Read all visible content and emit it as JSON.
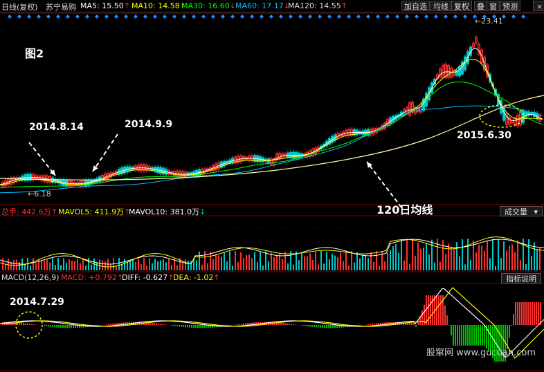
{
  "header": {
    "period": "日线(复权)",
    "stock": "苏宁易购",
    "ma": [
      {
        "label": "MA5: 15.50",
        "arrow": "↑",
        "color": "#ffffff"
      },
      {
        "label": "MA10: 14.58",
        "arrow": "↑",
        "color": "#ffff00"
      },
      {
        "label": "MA30: 16.60",
        "arrow": "↓",
        "color": "#00ff00"
      },
      {
        "label": "MA60: 17.17",
        "arrow": "↓",
        "color": "#00c0ff"
      },
      {
        "label": "MA120: 14.55",
        "arrow": "↑",
        "color": "#ffffff"
      }
    ],
    "buttons": [
      "加自选",
      "均线",
      "复权",
      "叠",
      "窗",
      "预测"
    ],
    "close_label": "×"
  },
  "main_chart": {
    "figure_label": "图2",
    "annotations": {
      "a1": "2014.8.14",
      "a2": "2014.9.9",
      "a3": "2015.6.30",
      "a4": "120日均线"
    },
    "high_label": "23.41",
    "low_label": "6.18"
  },
  "volume_panel": {
    "label_main": "总手: 442.6万",
    "label_main_arrow": "↑",
    "label_mavol5": "MAVOL5: 411.9万",
    "label_mavol5_arrow": "↑",
    "label_mavol10": "MAVOL10: 381.0万",
    "label_mavol10_arrow": "↓",
    "selector": "成交量"
  },
  "macd_panel": {
    "label_title": "MACD(12,26,9)",
    "label_macd": "MACD: +0.792",
    "label_macd_arrow": "↑",
    "label_diff": "DIFF: -0.627",
    "label_diff_arrow": "↑",
    "label_dea": "DEA: -1.02",
    "label_dea_arrow": "↑",
    "help_button": "指标说明",
    "annotation": "2014.7.29"
  },
  "watermark": "股窜网 www.gucuan.com",
  "colors": {
    "up": "#ff3030",
    "down": "#00c8c8",
    "grid": "#7a0000",
    "ma5": "#ffffff",
    "ma10": "#ffff00",
    "ma30": "#00ff00",
    "ma60": "#00c0ff",
    "ma120": "#ffffaa"
  }
}
